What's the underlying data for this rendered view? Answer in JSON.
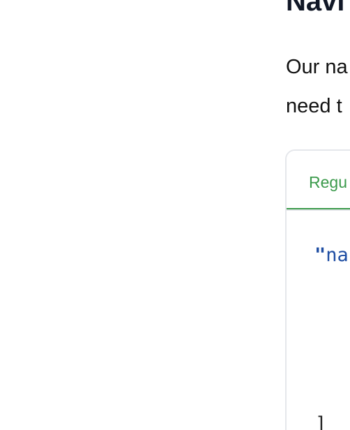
{
  "heading": "Navi",
  "paragraph": {
    "line1": "Our na",
    "line2": "need t"
  },
  "code_tabs": {
    "active_tab": "Regu",
    "accent_color": "#3b9a4b"
  },
  "code": {
    "line1_quote": "\"",
    "line1_text": "na",
    "line2": "]"
  }
}
